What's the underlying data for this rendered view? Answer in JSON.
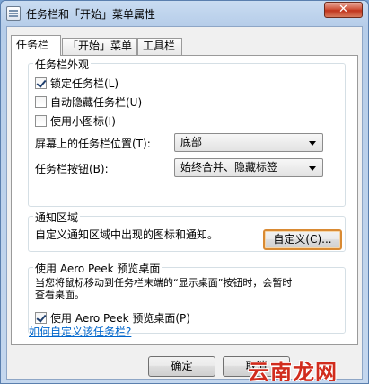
{
  "window": {
    "title": "任务栏和「开始」菜单属性",
    "close_glyph": "✕"
  },
  "tabs": [
    {
      "label": "任务栏",
      "active": true
    },
    {
      "label": "「开始」菜单",
      "active": false
    },
    {
      "label": "工具栏",
      "active": false
    }
  ],
  "appearance": {
    "title": "任务栏外观",
    "lock": {
      "label": "锁定任务栏(L)",
      "checked": true
    },
    "autohide": {
      "label": "自动隐藏任务栏(U)",
      "checked": false
    },
    "small_icons": {
      "label": "使用小图标(I)",
      "checked": false
    },
    "location_label": "屏幕上的任务栏位置(T):",
    "location_value": "底部",
    "buttons_label": "任务栏按钮(B):",
    "buttons_value": "始终合并、隐藏标签"
  },
  "notification": {
    "title": "通知区域",
    "description": "自定义通知区域中出现的图标和通知。",
    "customize_button": "自定义(C)..."
  },
  "aero": {
    "title": "使用 Aero Peek 预览桌面",
    "description_line1": "当您将鼠标移动到任务栏末端的“显示桌面”按钮时，会暂时",
    "description_line2": "查看桌面。",
    "checkbox": {
      "label": "使用 Aero Peek 预览桌面(P)",
      "checked": true
    }
  },
  "help_link": "如何自定义该任务栏?",
  "footer": {
    "ok_button": "确定",
    "cancel_button": "取消"
  },
  "watermark": "云南龙网",
  "colors": {
    "focus_border": "#d98a33",
    "link": "#0066cc",
    "watermark": "#d12c1d"
  }
}
